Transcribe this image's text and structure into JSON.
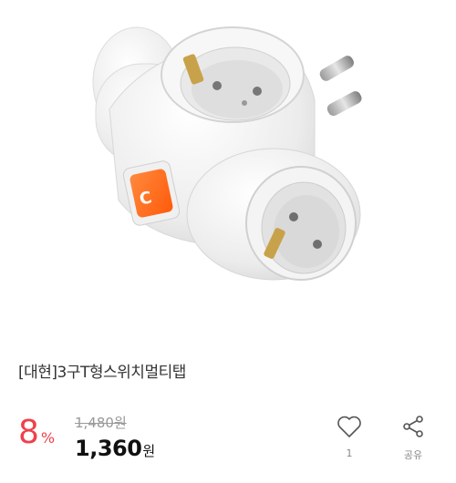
{
  "product": {
    "image_alt": "3구 T형 스위치 멀티탭",
    "title": "[대현]3구T형스위치멀티탭",
    "discount_rate": "8",
    "discount_unit": "%",
    "original_price": "1,480원",
    "sale_price": "1,360",
    "currency": "원"
  },
  "actions": {
    "like_icon": "heart-icon",
    "like_count": "1",
    "share_icon": "share-icon",
    "share_label": "공유"
  },
  "colors": {
    "discount": "#f0404a",
    "switch": "#ff6a1a",
    "body": "#f2f2f2"
  }
}
